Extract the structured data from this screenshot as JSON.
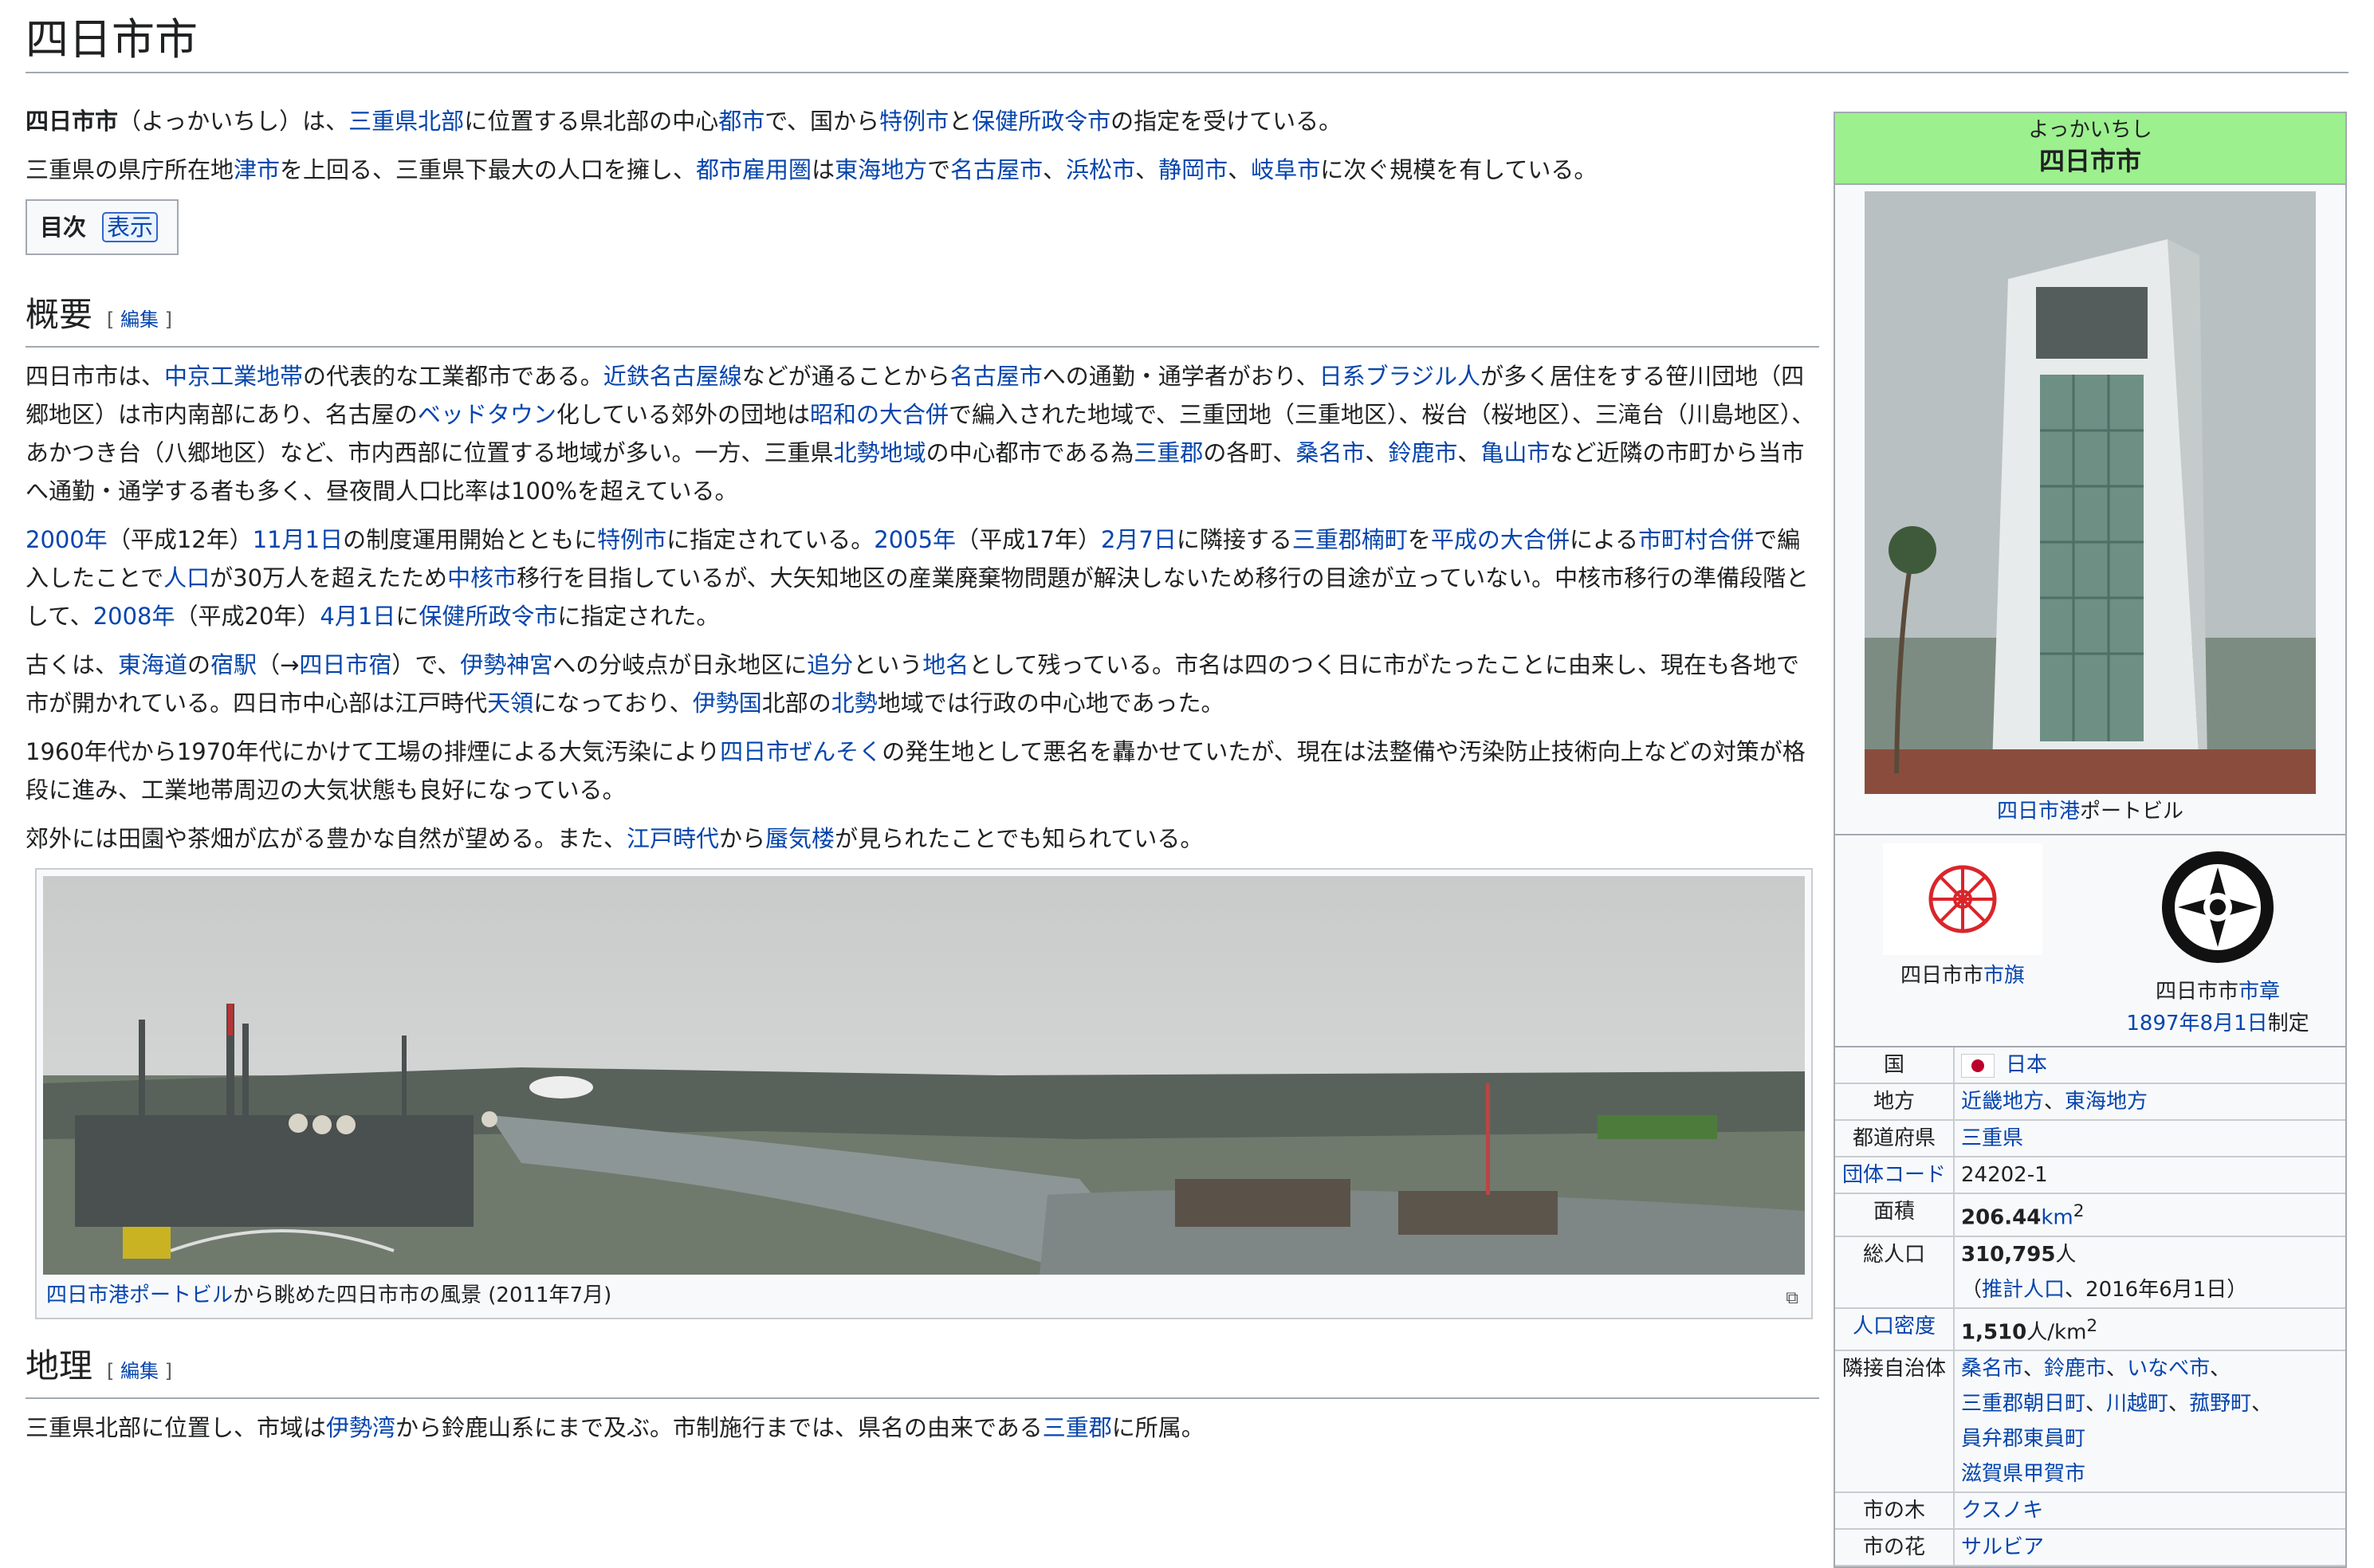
{
  "title": "四日市市",
  "intro": {
    "p1": [
      "四日市市",
      "（よっかいちし）は、",
      "三重県",
      "北部",
      "に位置する県北部の中心",
      "都市",
      "で、国から",
      "特例市",
      "と",
      "保健所政令市",
      "の指定を受けている。"
    ],
    "p2": [
      "三重県の県庁所在地",
      "津市",
      "を上回る、三重県下最大の人口を擁し、",
      "都市雇用圏",
      "は",
      "東海地方",
      "で",
      "名古屋市",
      "、",
      "浜松市",
      "、",
      "静岡市",
      "、",
      "岐阜市",
      "に次ぐ規模を有している。"
    ]
  },
  "toc": {
    "label": "目次",
    "toggle": "表示"
  },
  "edit_label": "編集",
  "sections": {
    "overview": {
      "heading": "概要",
      "p1": [
        "四日市市は、",
        "中京工業地帯",
        "の代表的な工業都市である。",
        "近鉄名古屋線",
        "などが通ることから",
        "名古屋市",
        "への通勤・通学者がおり、",
        "日系ブラジル人",
        "が多く居住をする笹川団地（四郷地区）は市内南部にあり、名古屋の",
        "ベッドタウン",
        "化している郊外の団地は",
        "昭和の大合併",
        "で編入された地域で、三重団地（三重地区）、桜台（桜地区）、三滝台（川島地区）、あかつき台（八郷地区）など、市内西部に位置する地域が多い。一方、三重県",
        "北勢地域",
        "の中心都市である為",
        "三重郡",
        "の各町、",
        "桑名市",
        "、",
        "鈴鹿市",
        "、",
        "亀山市",
        "など近隣の市町から当市へ通勤・通学する者も多く、昼夜間人口比率は100%を超えている。"
      ],
      "p2": [
        "2000年",
        "（平成12年）",
        "11月1日",
        "の制度運用開始とともに",
        "特例市",
        "に指定されている。",
        "2005年",
        "（平成17年）",
        "2月7日",
        "に隣接する",
        "三重郡楠町",
        "を",
        "平成の大合併",
        "による",
        "市町村合併",
        "で編入したことで",
        "人口",
        "が30万人を超えたため",
        "中核市",
        "移行を目指しているが、大矢知地区の産業廃棄物問題が解決しないため移行の目途が立っていない。中核市移行の準備段階として、",
        "2008年",
        "（平成20年）",
        "4月1日",
        "に",
        "保健所政令市",
        "に指定された。"
      ],
      "p3": [
        "古くは、",
        "東海道",
        "の",
        "宿駅",
        "（→",
        "四日市宿",
        "）で、",
        "伊勢神宮",
        "への分岐点が日永地区に",
        "追分",
        "という",
        "地名",
        "として残っている。市名は四のつく日に市がたったことに由来し、現在も各地で市が開かれている。四日市中心部は江戸時代",
        "天領",
        "になっており、",
        "伊勢国",
        "北部の",
        "北勢",
        "地域では行政の中心地であった。"
      ],
      "p4": [
        "1960年代から1970年代にかけて工場の排煙による大気汚染により",
        "四日市ぜんそく",
        "の発生地として悪名を轟かせていたが、現在は法整備や汚染防止技術向上などの対策が格段に進み、工業地帯周辺の大気状態も良好になっている。"
      ],
      "p5": [
        "郊外には田園や茶畑が広がる豊かな自然が望める。また、",
        "江戸時代",
        "から",
        "蜃気楼",
        "が見られたことでも知られている。"
      ],
      "caption": [
        "四日市港ポートビル",
        "から眺めた四日市市の風景 (2011年7月)"
      ]
    },
    "geography": {
      "heading": "地理",
      "p1": [
        "三重県北部に位置し、市域は",
        "伊勢湾",
        "から鈴鹿山系にまで及ぶ。市制施行までは、県名の由来である",
        "三重郡",
        "に所属。"
      ]
    }
  },
  "infobox": {
    "kana": "よっかいちし",
    "name": "四日市市",
    "photo_caption": [
      "四日市港",
      "ポートビル"
    ],
    "flag_caption": [
      "四日市市",
      "市旗"
    ],
    "emblem_caption": [
      "四日市市",
      "市章"
    ],
    "emblem_date": [
      "1897年",
      "8月1日",
      "制定"
    ],
    "rows": {
      "country": {
        "label": "国",
        "value": "日本"
      },
      "region": {
        "label": "地方",
        "value": [
          "近畿地方",
          "、",
          "東海地方"
        ]
      },
      "prefecture": {
        "label": "都道府県",
        "value": "三重県"
      },
      "code": {
        "label": "団体コード",
        "value": "24202-1"
      },
      "area": {
        "label": "面積",
        "value": "206.44",
        "unit": "km",
        "sup": "2"
      },
      "population": {
        "label": "総人口",
        "value": "310,795",
        "unit": "人",
        "note": [
          "（",
          "推計人口",
          "、2016年6月1日）"
        ]
      },
      "density": {
        "label": "人口密度",
        "value": "1,510",
        "unit": "人/km",
        "sup": "2"
      },
      "neighbors": {
        "label": "隣接自治体",
        "line1": [
          "桑名市",
          "、",
          "鈴鹿市",
          "、",
          "いなべ市",
          "、"
        ],
        "line2": [
          "三重郡朝日町",
          "、",
          "川越町",
          "、",
          "菰野町",
          "、"
        ],
        "line3": "員弁郡東員町",
        "line4": "滋賀県甲賀市"
      },
      "tree": {
        "label": "市の木",
        "value": "クスノキ"
      },
      "flower": {
        "label": "市の花",
        "value": "サルビア"
      }
    }
  }
}
